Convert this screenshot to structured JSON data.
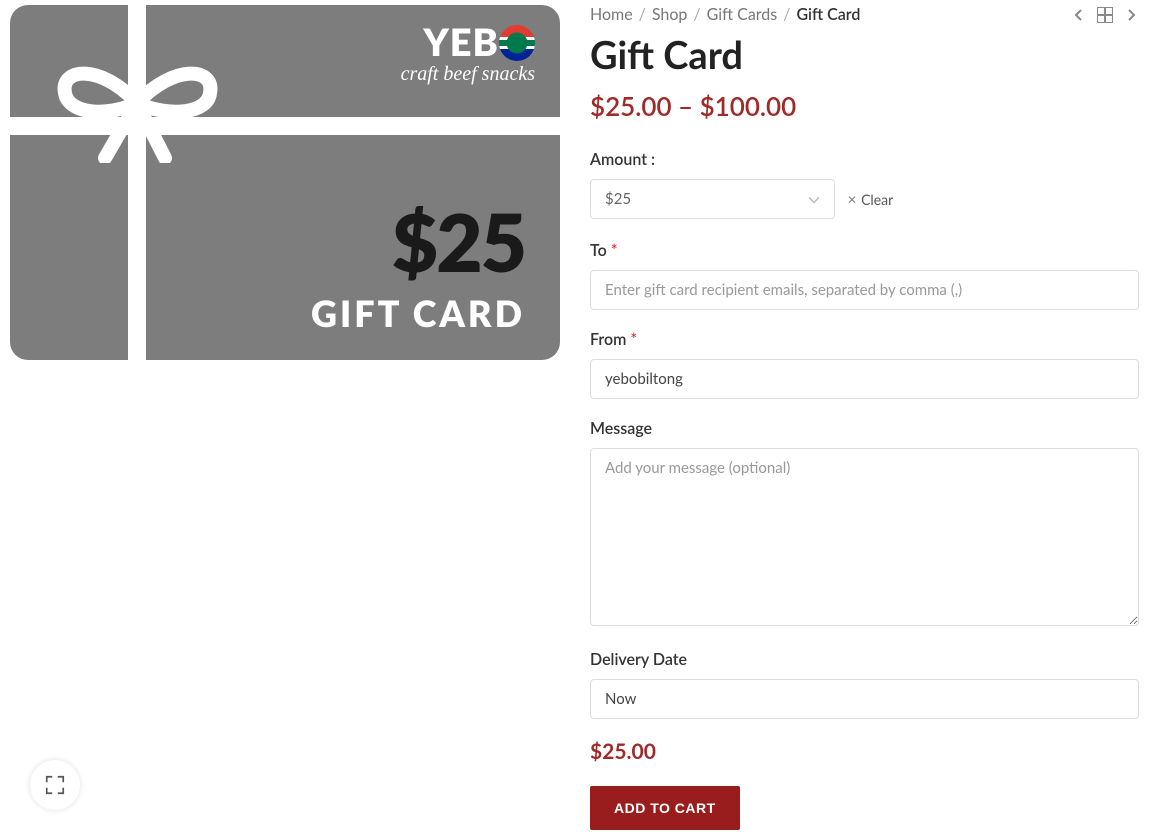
{
  "breadcrumbs": {
    "home": "Home",
    "shop": "Shop",
    "giftcards": "Gift Cards",
    "current": "Gift Card"
  },
  "title": "Gift Card",
  "price_range": "$25.00 – $100.00",
  "amount": {
    "label": "Amount",
    "selected": "$25",
    "clear": "Clear"
  },
  "to": {
    "label": "To",
    "placeholder": "Enter gift card recipient emails, separated by comma (,)"
  },
  "from": {
    "label": "From",
    "value": "yebobiltong"
  },
  "message": {
    "label": "Message",
    "placeholder": "Add your message (optional)"
  },
  "delivery": {
    "label": "Delivery Date",
    "value": "Now"
  },
  "price_final": "$25.00",
  "add_to_cart": "ADD TO CART",
  "card_image": {
    "brand": "YEB",
    "tagline": "craft beef snacks",
    "amount": "$25",
    "label": "GIFT CARD"
  }
}
